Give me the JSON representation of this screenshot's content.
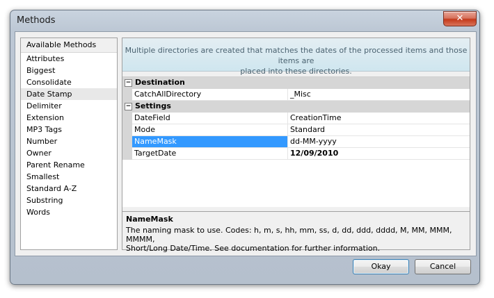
{
  "window": {
    "title": "Methods",
    "close_glyph": "✕"
  },
  "methods": {
    "header": "Available Methods",
    "items": [
      "Attributes",
      "Biggest",
      "Consolidate",
      "Date Stamp",
      "Delimiter",
      "Extension",
      "MP3 Tags",
      "Number",
      "Owner",
      "Parent Rename",
      "Smallest",
      "Standard A-Z",
      "Substring",
      "Words"
    ],
    "selected": "Date Stamp"
  },
  "description": {
    "line1": "Multiple directories are created that matches the dates of the processed items and those items are",
    "line2": "placed into these directories."
  },
  "properties": {
    "toggle_glyph": "−",
    "categories": [
      {
        "label": "Destination",
        "rows": [
          {
            "name": "CatchAllDirectory",
            "value": "_Misc"
          }
        ]
      },
      {
        "label": "Settings",
        "rows": [
          {
            "name": "DateField",
            "value": "CreationTime"
          },
          {
            "name": "Mode",
            "value": "Standard"
          },
          {
            "name": "NameMask",
            "value": "dd-MM-yyyy"
          },
          {
            "name": "TargetDate",
            "value": "12/09/2010"
          }
        ]
      }
    ],
    "selected_row": "NameMask"
  },
  "help": {
    "title": "NameMask",
    "line1": "The naming mask to use. Codes: h, m, s, hh, mm, ss, d, dd, ddd, dddd, M, MM, MMM, MMMM,",
    "line2": "Short/Long Date/Time. See documentation for further information."
  },
  "buttons": {
    "okay": "Okay",
    "cancel": "Cancel"
  },
  "colors": {
    "selection": "#3399ff",
    "banner_text": "#4a6270",
    "close_button": "#c43a1c"
  }
}
